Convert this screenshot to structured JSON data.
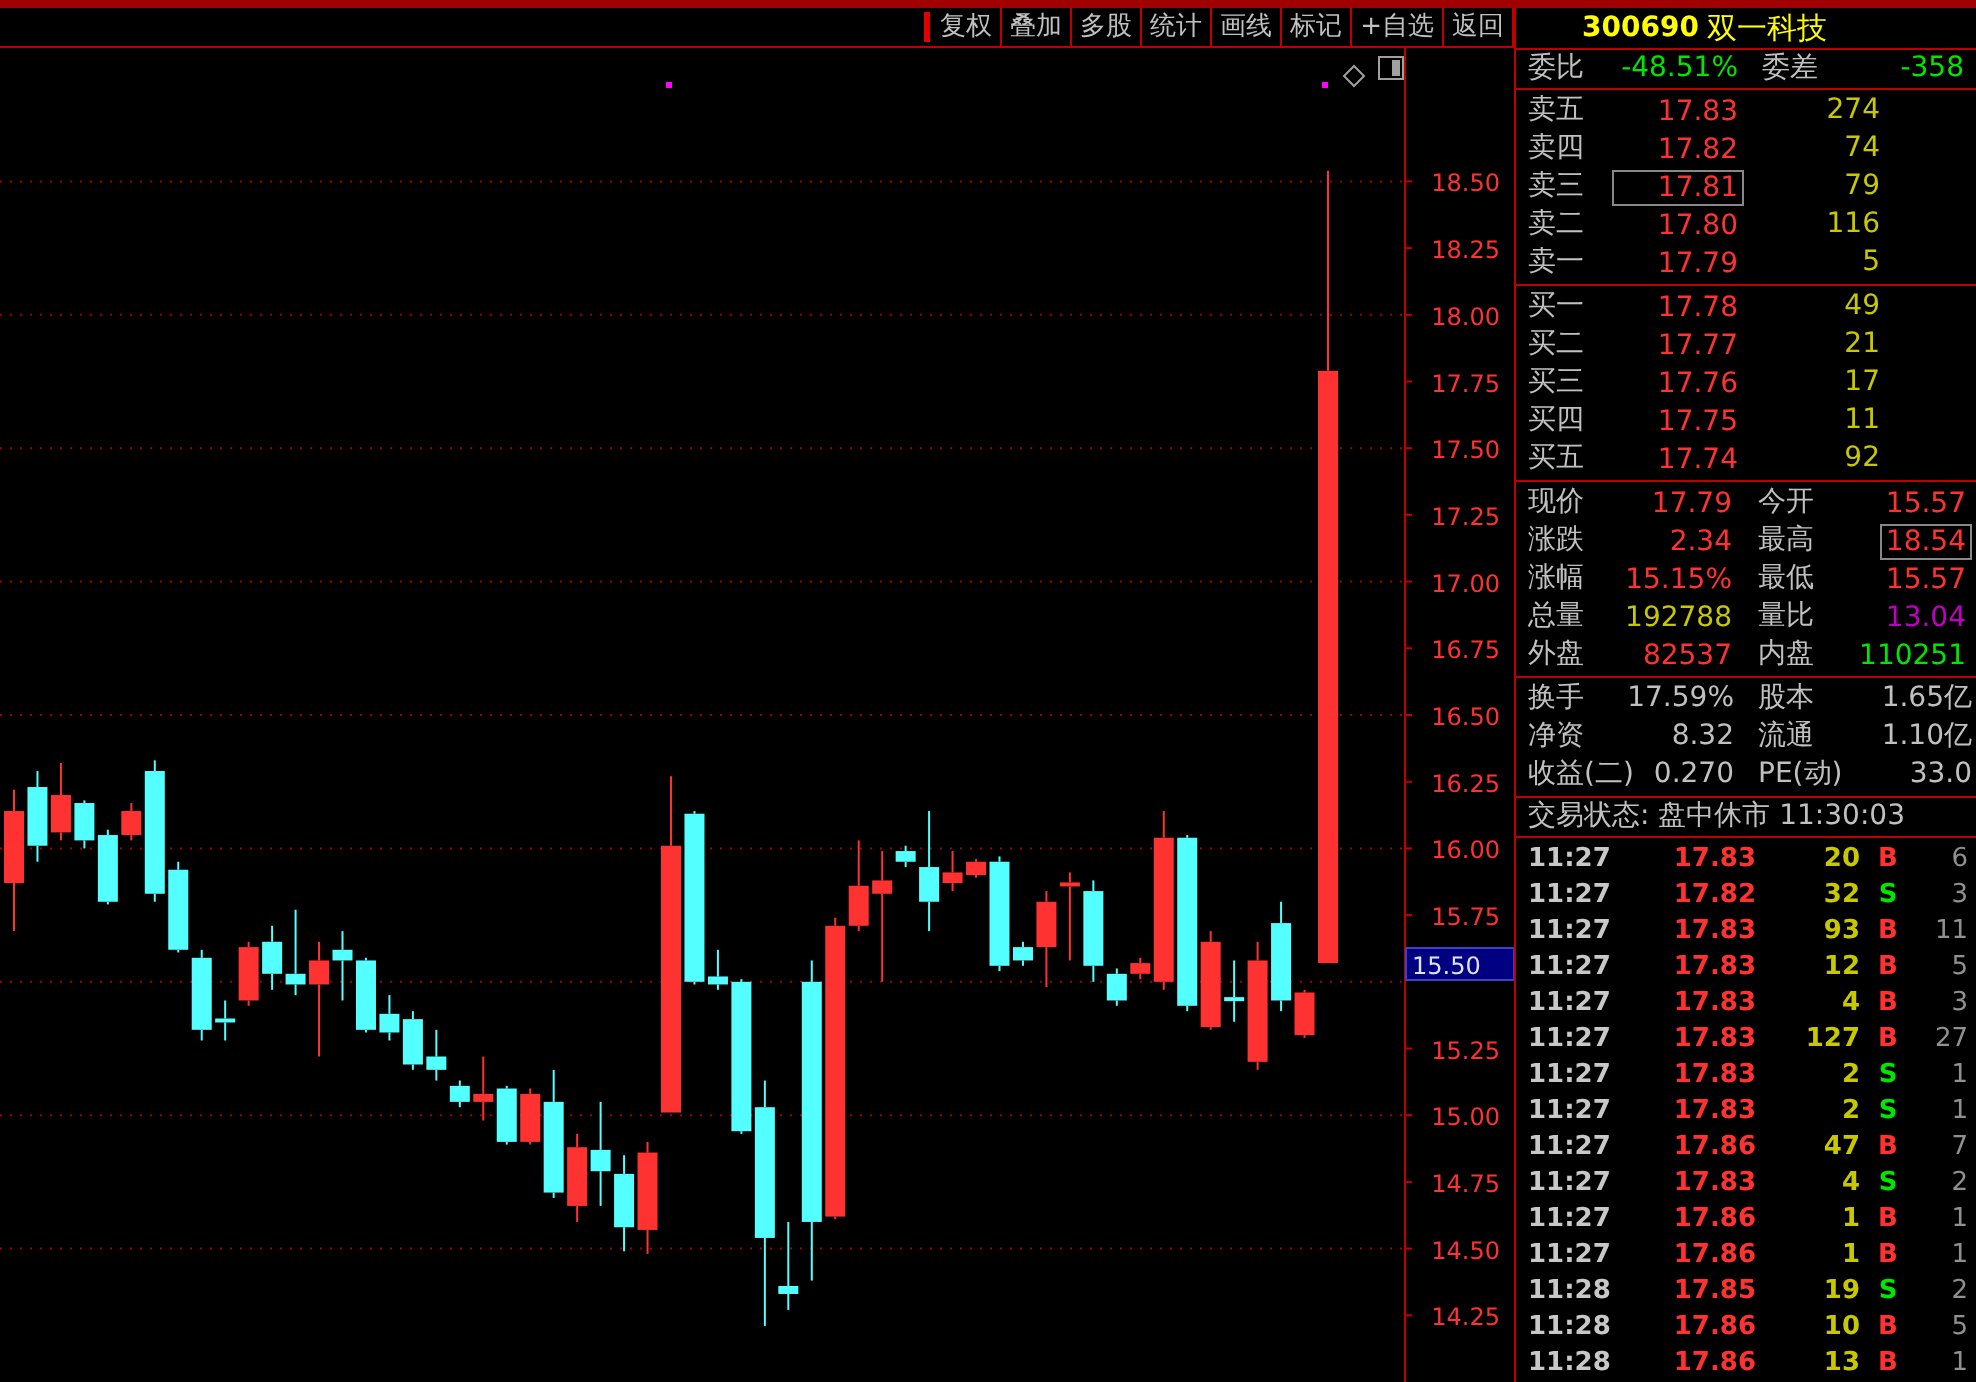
{
  "toolbar": {
    "buttons": [
      "复权",
      "叠加",
      "多股",
      "统计",
      "画线",
      "标记",
      "+自选",
      "返回"
    ]
  },
  "chart": {
    "price_marker": "15.50",
    "chart_data": {
      "type": "candlestick",
      "grid": true,
      "ylim": [
        14.0,
        19.0
      ],
      "ohlc": [
        [
          15.87,
          16.22,
          15.69,
          16.14
        ],
        [
          16.23,
          16.29,
          15.95,
          16.01
        ],
        [
          16.06,
          16.32,
          16.03,
          16.2
        ],
        [
          16.17,
          16.18,
          16.0,
          16.03
        ],
        [
          16.05,
          16.07,
          15.79,
          15.8
        ],
        [
          16.05,
          16.17,
          16.03,
          16.14
        ],
        [
          16.29,
          16.33,
          15.8,
          15.83
        ],
        [
          15.92,
          15.95,
          15.61,
          15.62
        ],
        [
          15.59,
          15.62,
          15.28,
          15.32
        ],
        [
          15.36,
          15.43,
          15.28,
          15.35
        ],
        [
          15.43,
          15.65,
          15.41,
          15.63
        ],
        [
          15.65,
          15.71,
          15.47,
          15.53
        ],
        [
          15.53,
          15.77,
          15.45,
          15.49
        ],
        [
          15.49,
          15.65,
          15.22,
          15.58
        ],
        [
          15.62,
          15.69,
          15.43,
          15.58
        ],
        [
          15.58,
          15.59,
          15.31,
          15.32
        ],
        [
          15.38,
          15.45,
          15.28,
          15.31
        ],
        [
          15.36,
          15.39,
          15.17,
          15.19
        ],
        [
          15.22,
          15.32,
          15.13,
          15.17
        ],
        [
          15.11,
          15.13,
          15.03,
          15.05
        ],
        [
          15.05,
          15.22,
          14.98,
          15.08
        ],
        [
          15.1,
          15.11,
          14.89,
          14.9
        ],
        [
          14.9,
          15.1,
          14.89,
          15.08
        ],
        [
          15.05,
          15.17,
          14.69,
          14.71
        ],
        [
          14.66,
          14.93,
          14.6,
          14.88
        ],
        [
          14.87,
          15.05,
          14.66,
          14.79
        ],
        [
          14.78,
          14.85,
          14.49,
          14.58
        ],
        [
          14.57,
          14.9,
          14.48,
          14.86
        ],
        [
          15.01,
          16.27,
          15.01,
          16.01
        ],
        [
          16.13,
          16.14,
          15.49,
          15.5
        ],
        [
          15.52,
          15.62,
          15.47,
          15.49
        ],
        [
          15.5,
          15.51,
          14.93,
          14.94
        ],
        [
          15.03,
          15.13,
          14.21,
          14.54
        ],
        [
          14.36,
          14.6,
          14.27,
          14.33
        ],
        [
          15.5,
          15.58,
          14.38,
          14.6
        ],
        [
          14.62,
          15.74,
          14.61,
          15.71
        ],
        [
          15.71,
          16.03,
          15.69,
          15.86
        ],
        [
          15.83,
          15.99,
          15.5,
          15.88
        ],
        [
          15.99,
          16.01,
          15.93,
          15.95
        ],
        [
          15.93,
          16.14,
          15.69,
          15.8
        ],
        [
          15.87,
          15.99,
          15.84,
          15.91
        ],
        [
          15.9,
          15.96,
          15.89,
          15.95
        ],
        [
          15.95,
          15.97,
          15.54,
          15.56
        ],
        [
          15.63,
          15.65,
          15.56,
          15.58
        ],
        [
          15.63,
          15.84,
          15.48,
          15.8
        ],
        [
          15.86,
          15.91,
          15.58,
          15.87
        ],
        [
          15.84,
          15.88,
          15.5,
          15.56
        ],
        [
          15.53,
          15.55,
          15.41,
          15.43
        ],
        [
          15.53,
          15.59,
          15.51,
          15.57
        ],
        [
          15.5,
          16.14,
          15.47,
          16.04
        ],
        [
          16.04,
          16.05,
          15.39,
          15.41
        ],
        [
          15.33,
          15.69,
          15.32,
          15.65
        ],
        [
          15.44,
          15.58,
          15.35,
          15.43
        ],
        [
          15.2,
          15.65,
          15.17,
          15.58
        ],
        [
          15.72,
          15.8,
          15.39,
          15.43
        ],
        [
          15.3,
          15.47,
          15.29,
          15.46
        ],
        [
          15.57,
          18.54,
          15.57,
          17.79
        ]
      ],
      "yticks": [
        {
          "value": 18.5,
          "label": "18.50"
        },
        {
          "value": 18.25,
          "label": "18.25"
        },
        {
          "value": 18,
          "label": "18.00"
        },
        {
          "value": 17.75,
          "label": "17.75"
        },
        {
          "value": 17.5,
          "label": "17.50"
        },
        {
          "value": 17.25,
          "label": "17.25"
        },
        {
          "value": 17,
          "label": "17.00"
        },
        {
          "value": 16.75,
          "label": "16.75"
        },
        {
          "value": 16.5,
          "label": "16.50"
        },
        {
          "value": 16.25,
          "label": "16.25"
        },
        {
          "value": 16,
          "label": "16.00"
        },
        {
          "value": 15.75,
          "label": "15.75"
        },
        {
          "value": 15.25,
          "label": "15.25"
        },
        {
          "value": 15,
          "label": "15.00"
        },
        {
          "value": 14.75,
          "label": "14.75"
        },
        {
          "value": 14.5,
          "label": "14.50"
        },
        {
          "value": 14.25,
          "label": "14.25"
        }
      ]
    }
  },
  "stock": {
    "code": "300690",
    "name": "双一科技"
  },
  "order_ratio": {
    "label": "委比",
    "value": "-48.51%",
    "diff_label": "委差",
    "diff_value": "-358"
  },
  "asks": [
    {
      "label": "卖五",
      "price": "17.83",
      "volume": "274",
      "selected": false
    },
    {
      "label": "卖四",
      "price": "17.82",
      "volume": "74",
      "selected": false
    },
    {
      "label": "卖三",
      "price": "17.81",
      "volume": "79",
      "selected": true
    },
    {
      "label": "卖二",
      "price": "17.80",
      "volume": "116",
      "selected": false
    },
    {
      "label": "卖一",
      "price": "17.79",
      "volume": "5",
      "selected": false
    }
  ],
  "bids": [
    {
      "label": "买一",
      "price": "17.78",
      "volume": "49",
      "selected": false
    },
    {
      "label": "买二",
      "price": "17.77",
      "volume": "21",
      "selected": false
    },
    {
      "label": "买三",
      "price": "17.76",
      "volume": "17",
      "selected": false
    },
    {
      "label": "买四",
      "price": "17.75",
      "volume": "11",
      "selected": false
    },
    {
      "label": "买五",
      "price": "17.74",
      "volume": "92",
      "selected": false
    }
  ],
  "quote": [
    {
      "label": "现价",
      "value": "17.79",
      "color": "#ff3232",
      "selected": false
    },
    {
      "label": "今开",
      "value": "15.57",
      "color": "#ff3232",
      "selected": false
    },
    {
      "label": "涨跌",
      "value": "2.34",
      "color": "#ff3232",
      "selected": false
    },
    {
      "label": "最高",
      "value": "18.54",
      "color": "#ff3232",
      "selected": true
    },
    {
      "label": "涨幅",
      "value": "15.15%",
      "color": "#ff3232",
      "selected": false
    },
    {
      "label": "最低",
      "value": "15.57",
      "color": "#ff3232",
      "selected": false
    },
    {
      "label": "总量",
      "value": "192788",
      "color": "#c8c800",
      "selected": false
    },
    {
      "label": "量比",
      "value": "13.04",
      "color": "#c000c0",
      "selected": false
    },
    {
      "label": "外盘",
      "value": "82537",
      "color": "#ff3232",
      "selected": false
    },
    {
      "label": "内盘",
      "value": "110251",
      "color": "#00e600",
      "selected": false
    }
  ],
  "fundamentals": [
    {
      "label": "换手",
      "value": "17.59%"
    },
    {
      "label": "股本",
      "value": "1.65亿"
    },
    {
      "label": "净资",
      "value": "8.32"
    },
    {
      "label": "流通",
      "value": "1.10亿"
    },
    {
      "label": "收益(二)",
      "value": "0.270"
    },
    {
      "label": "PE(动)",
      "value": "33.0"
    }
  ],
  "status": "交易状态: 盘中休市 11:30:03",
  "trades": [
    {
      "time": "11:27",
      "price": "17.83",
      "volume": "20",
      "side": "B",
      "kind": "buy",
      "count": "6"
    },
    {
      "time": "11:27",
      "price": "17.82",
      "volume": "32",
      "side": "S",
      "kind": "sell",
      "count": "3"
    },
    {
      "time": "11:27",
      "price": "17.83",
      "volume": "93",
      "side": "B",
      "kind": "buy",
      "count": "11"
    },
    {
      "time": "11:27",
      "price": "17.83",
      "volume": "12",
      "side": "B",
      "kind": "buy",
      "count": "5"
    },
    {
      "time": "11:27",
      "price": "17.83",
      "volume": "4",
      "side": "B",
      "kind": "buy",
      "count": "3"
    },
    {
      "time": "11:27",
      "price": "17.83",
      "volume": "127",
      "side": "B",
      "kind": "buy",
      "count": "27"
    },
    {
      "time": "11:27",
      "price": "17.83",
      "volume": "2",
      "side": "S",
      "kind": "sell",
      "count": "1"
    },
    {
      "time": "11:27",
      "price": "17.83",
      "volume": "2",
      "side": "S",
      "kind": "sell",
      "count": "1"
    },
    {
      "time": "11:27",
      "price": "17.86",
      "volume": "47",
      "side": "B",
      "kind": "buy",
      "count": "7"
    },
    {
      "time": "11:27",
      "price": "17.83",
      "volume": "4",
      "side": "S",
      "kind": "sell",
      "count": "2"
    },
    {
      "time": "11:27",
      "price": "17.86",
      "volume": "1",
      "side": "B",
      "kind": "buy",
      "count": "1"
    },
    {
      "time": "11:27",
      "price": "17.86",
      "volume": "1",
      "side": "B",
      "kind": "buy",
      "count": "1"
    },
    {
      "time": "11:28",
      "price": "17.85",
      "volume": "19",
      "side": "S",
      "kind": "sell",
      "count": "2"
    },
    {
      "time": "11:28",
      "price": "17.86",
      "volume": "10",
      "side": "B",
      "kind": "buy",
      "count": "5"
    },
    {
      "time": "11:28",
      "price": "17.86",
      "volume": "13",
      "side": "B",
      "kind": "buy",
      "count": "1"
    }
  ]
}
